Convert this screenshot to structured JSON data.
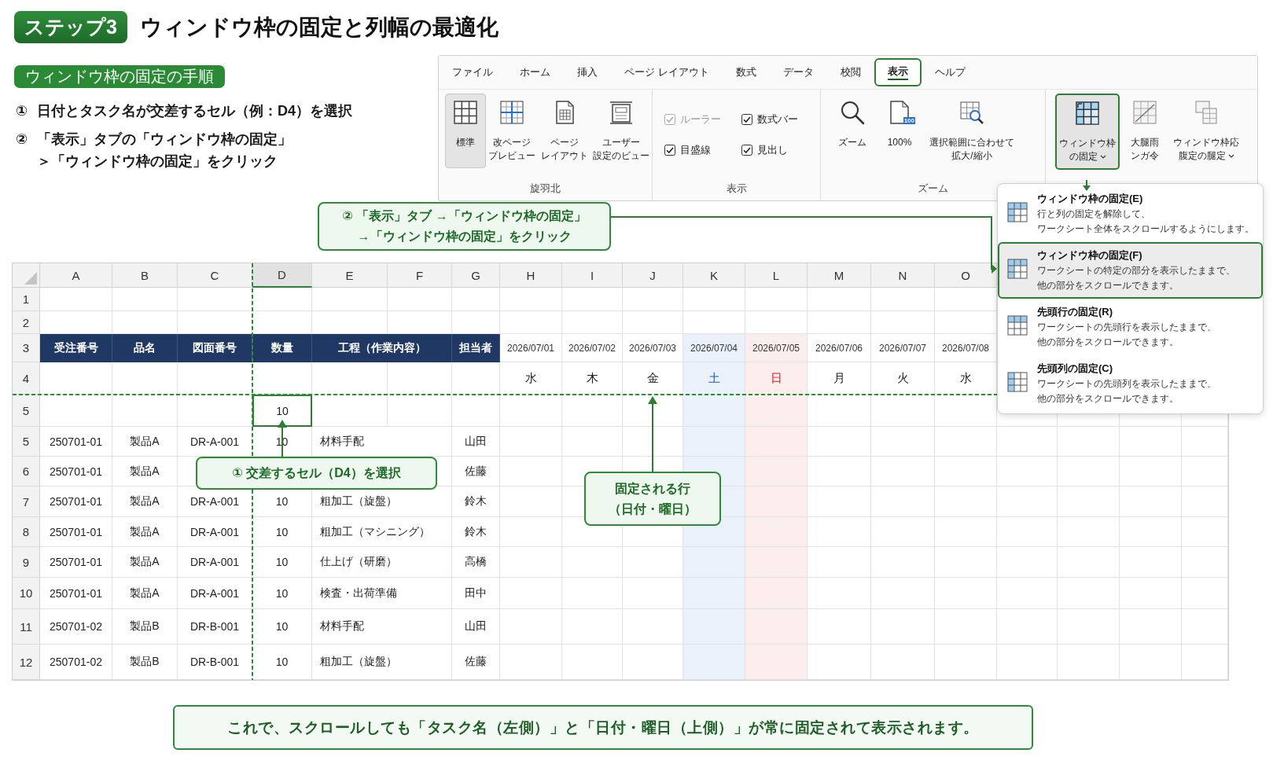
{
  "header": {
    "step": "ステップ3",
    "title": "ウィンドウ枠の固定と列幅の最適化"
  },
  "procedure": {
    "heading": "ウィンドウ枠の固定の手順",
    "steps": [
      {
        "marker": "①",
        "lines": [
          "日付とタスク名が交差するセル（例：D4）を選択"
        ]
      },
      {
        "marker": "②",
        "lines": [
          "「表示」タブの「ウィンドウ枠の固定」",
          "＞「ウィンドウ枠の固定」をクリック"
        ]
      }
    ]
  },
  "ribbon": {
    "tabs": [
      {
        "label": "ファイル",
        "selected": false
      },
      {
        "label": "ホーム",
        "selected": false
      },
      {
        "label": "挿入",
        "selected": false
      },
      {
        "label": "ページ レイアウト",
        "selected": false
      },
      {
        "label": "数式",
        "selected": false
      },
      {
        "label": "データ",
        "selected": false
      },
      {
        "label": "校閲",
        "selected": false
      },
      {
        "label": "表示",
        "selected": true
      },
      {
        "label": "ヘルプ",
        "selected": false
      }
    ],
    "groups": [
      {
        "label": "旋羽北",
        "items": [
          {
            "kind": "button",
            "lines": [
              "標準"
            ],
            "selected": true,
            "highlighted": false,
            "dropdown": false
          },
          {
            "kind": "button",
            "lines": [
              "改ページ",
              "プレビュー"
            ],
            "selected": false,
            "highlighted": false,
            "dropdown": false
          },
          {
            "kind": "button",
            "lines": [
              "ページ",
              "レイアウト"
            ],
            "selected": false,
            "highlighted": false,
            "dropdown": false
          },
          {
            "kind": "button",
            "lines": [
              "ユーザー",
              "設定のビュー"
            ],
            "selected": false,
            "highlighted": false,
            "dropdown": false
          }
        ]
      },
      {
        "label": "表示",
        "items": [
          {
            "kind": "checkbox",
            "label": "ルーラー",
            "checked": true,
            "disabled": true
          },
          {
            "kind": "checkbox",
            "label": "数式バー",
            "checked": true,
            "disabled": false
          },
          {
            "kind": "checkbox",
            "label": "目盛線",
            "checked": true,
            "disabled": false
          },
          {
            "kind": "checkbox",
            "label": "見出し",
            "checked": true,
            "disabled": false
          }
        ]
      },
      {
        "label": "ズーム",
        "items": [
          {
            "kind": "button",
            "lines": [
              "ズーム"
            ],
            "selected": false,
            "highlighted": false,
            "dropdown": false
          },
          {
            "kind": "button",
            "lines": [
              "100%"
            ],
            "badge": "100",
            "selected": false,
            "highlighted": false,
            "dropdown": false
          },
          {
            "kind": "button",
            "lines": [
              "選択範囲に合わせて",
              "拡大/縮小"
            ],
            "selected": false,
            "highlighted": false,
            "dropdown": false
          }
        ]
      },
      {
        "items": [
          {
            "kind": "button",
            "lines": [
              "ウィンドウ枠",
              "の固定"
            ],
            "selected": true,
            "highlighted": true,
            "dropdown": true
          },
          {
            "kind": "button",
            "lines": [
              "大腿雨",
              "ンガ令"
            ],
            "selected": false,
            "highlighted": false,
            "dropdown": false
          },
          {
            "kind": "button",
            "lines": [
              "ウィンドウ枠応",
              "腹定の腿定"
            ],
            "selected": false,
            "highlighted": false,
            "dropdown": true
          }
        ]
      }
    ]
  },
  "menu": {
    "items": [
      {
        "title": "ウィンドウ枠の固定(E)",
        "description": [
          "行と列の固定を解除して、",
          "ワークシート全体をスクロールするようにします。"
        ],
        "selected": false
      },
      {
        "title": "ウィンドウ枠の固定(F)",
        "description": [
          "ワークシートの特定の部分を表示したままで、",
          "他の部分をスクロールできます。"
        ],
        "selected": true
      },
      {
        "title": "先頭行の固定(R)",
        "description": [
          "ワークシートの先頭行を表示したままで、",
          "他の部分をスクロールできます。"
        ],
        "selected": false
      },
      {
        "title": "先頭列の固定(C)",
        "description": [
          "ワークシートの先頭列を表示したままで、",
          "他の部分をスクロールできます。"
        ],
        "selected": false
      }
    ]
  },
  "callouts": [
    {
      "lines": [
        "② 「表示」タブ →「ウィンドウ枠の固定」",
        "→「ウィンドウ枠の固定」をクリック"
      ]
    },
    {
      "lines": [
        "① 交差するセル（D4）を選択"
      ]
    },
    {
      "lines": [
        "固定される行",
        "（日付・曜日）"
      ]
    }
  ],
  "sheet": {
    "columns": [
      {
        "label": "A",
        "selected": false
      },
      {
        "label": "B",
        "selected": false
      },
      {
        "label": "C",
        "selected": false
      },
      {
        "label": "D",
        "selected": true
      },
      {
        "label": "E",
        "selected": false
      },
      {
        "label": "F",
        "selected": false
      },
      {
        "label": "G",
        "selected": false
      },
      {
        "label": "H",
        "selected": false
      },
      {
        "label": "I",
        "selected": false
      },
      {
        "label": "J",
        "selected": false
      },
      {
        "label": "K",
        "selected": false
      },
      {
        "label": "L",
        "selected": false
      },
      {
        "label": "M",
        "selected": false
      },
      {
        "label": "N",
        "selected": false
      },
      {
        "label": "O",
        "selected": false
      }
    ],
    "days": [
      {
        "date": "2026/07/01",
        "weekday": "水",
        "kind": "weekday"
      },
      {
        "date": "2026/07/02",
        "weekday": "木",
        "kind": "weekday"
      },
      {
        "date": "2026/07/03",
        "weekday": "金",
        "kind": "weekday"
      },
      {
        "date": "2026/07/04",
        "weekday": "土",
        "kind": "saturday"
      },
      {
        "date": "2026/07/05",
        "weekday": "日",
        "kind": "sunday"
      },
      {
        "date": "2026/07/06",
        "weekday": "月",
        "kind": "weekday"
      },
      {
        "date": "2026/07/07",
        "weekday": "火",
        "kind": "weekday"
      },
      {
        "date": "2026/07/08",
        "weekday": "水",
        "kind": "weekday"
      }
    ],
    "rows": [
      {
        "number": "1",
        "kind": "blank"
      },
      {
        "number": "2",
        "kind": "blank"
      },
      {
        "number": "3",
        "kind": "header",
        "cells": [
          "受注番号",
          "品名",
          "図面番号",
          "数量",
          "工程（作業内容）",
          "担当者"
        ]
      },
      {
        "number": "4",
        "kind": "weekdays"
      },
      {
        "number": "5",
        "kind": "data",
        "qty": {
          "text": "10",
          "selected": true
        }
      },
      {
        "number": "5",
        "kind": "data",
        "order": "250701-01",
        "product": "製品A",
        "drawing": "DR-A-001",
        "qty": {
          "text": "10",
          "selected": false
        },
        "task": "材料手配",
        "owner": "山田"
      },
      {
        "number": "6",
        "kind": "data",
        "order": "250701-01",
        "product": "製品A",
        "owner": "佐藤"
      },
      {
        "number": "7",
        "kind": "data",
        "order": "250701-01",
        "product": "製品A",
        "drawing": "DR-A-001",
        "qty": {
          "text": "10",
          "selected": false
        },
        "task": "粗加工（旋盤）",
        "owner": "鈴木"
      },
      {
        "number": "8",
        "kind": "data",
        "order": "250701-01",
        "product": "製品A",
        "drawing": "DR-A-001",
        "qty": {
          "text": "10",
          "selected": false
        },
        "task": "粗加工（マシニング）",
        "owner": "鈴木"
      },
      {
        "number": "9",
        "kind": "data",
        "order": "250701-01",
        "product": "製品A",
        "drawing": "DR-A-001",
        "qty": {
          "text": "10",
          "selected": false
        },
        "task": "仕上げ（研磨）",
        "owner": "高橋"
      },
      {
        "number": "10",
        "kind": "data",
        "order": "250701-01",
        "product": "製品A",
        "drawing": "DR-A-001",
        "qty": {
          "text": "10",
          "selected": false
        },
        "task": "検査・出荷準備",
        "owner": "田中"
      },
      {
        "number": "11",
        "kind": "data",
        "order": "250701-02",
        "product": "製品B",
        "drawing": "DR-B-001",
        "qty": {
          "text": "10",
          "selected": false
        },
        "task": "材料手配",
        "owner": "山田"
      },
      {
        "number": "12",
        "kind": "data",
        "order": "250701-02",
        "product": "製品B",
        "drawing": "DR-B-001",
        "qty": {
          "text": "10",
          "selected": false
        },
        "task": "粗加工（旋盤）",
        "owner": "佐藤"
      }
    ]
  },
  "summary": "これで、スクロールしても「タスク名（左側）」と「日付・曜日（上側）」が常に固定されて表示されます。"
}
